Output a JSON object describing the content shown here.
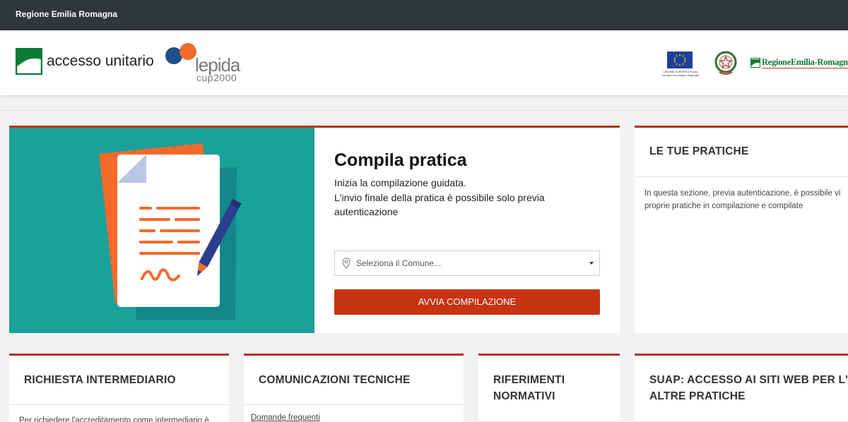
{
  "topbar": {
    "title": "Regione Emilia Romagna"
  },
  "header": {
    "logo_text": "accesso unitario",
    "lepida_word": "lepida",
    "lepida_sub": "cup2000",
    "eu_text": "UNIONE EUROPEA Fondo europeo di sviluppo regionale",
    "rer_name": "RegioneEmilia-Romagna"
  },
  "compila": {
    "title": "Compila pratica",
    "desc_line1": "Inizia la compilazione guidata.",
    "desc_line2": "L'invio finale della pratica è possibile solo previa autenticazione",
    "select_placeholder": "Seleziona il Comune...",
    "button_label": "AVVIA COMPILAZIONE"
  },
  "tue_pratiche": {
    "title": "LE TUE PRATICHE",
    "body_line1": "In questa sezione, previa autenticazione, è possibile vi",
    "body_line2": "proprie pratiche in compilazione e compilate"
  },
  "cards": {
    "intermediario": {
      "title": "RICHIESTA INTERMEDIARIO",
      "body": "Per richiedere l'accreditamento come intermediario è"
    },
    "comunicazioni": {
      "title": "COMUNICAZIONI TECNICHE",
      "link": "Domande frequenti"
    },
    "riferimenti": {
      "title_line1": "RIFERIMENTI",
      "title_line2": "NORMATIVI"
    },
    "suap": {
      "title_line1": "SUAP: ACCESSO AI SITI WEB PER L'I",
      "title_line2": "ALTRE PRATICHE"
    }
  },
  "colors": {
    "topbar": "#30373b",
    "accent_red": "#c83312",
    "illustration_teal": "#1aa19a",
    "paper_orange": "#f26a2b",
    "pen_blue": "#2c3e8f"
  }
}
